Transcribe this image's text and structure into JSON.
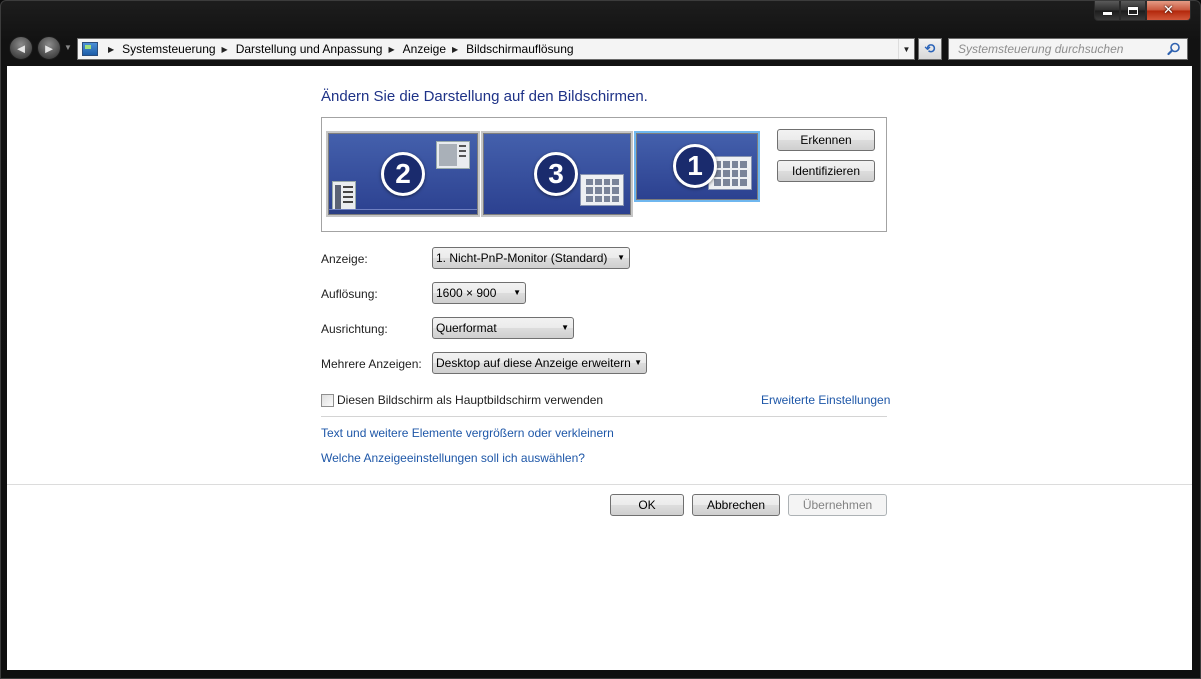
{
  "window": {
    "caption_buttons": {
      "minimize_icon": "minimize-icon",
      "maximize_icon": "maximize-icon",
      "close_icon": "close-icon",
      "close_glyph": "✕"
    }
  },
  "nav": {
    "back_glyph": "◄",
    "forward_glyph": "►",
    "breadcrumbs": [
      "Systemsteuerung",
      "Darstellung und Anpassung",
      "Anzeige",
      "Bildschirmauflösung"
    ],
    "refresh_glyph": "⟲",
    "search_placeholder": "Systemsteuerung durchsuchen"
  },
  "main": {
    "title": "Ändern Sie die Darstellung auf den Bildschirmen.",
    "monitors": [
      {
        "number": "2",
        "selected": false
      },
      {
        "number": "3",
        "selected": false
      },
      {
        "number": "1",
        "selected": true
      }
    ],
    "detect_button": "Erkennen",
    "identify_button": "Identifizieren",
    "fields": {
      "display_label": "Anzeige:",
      "display_value": "1. Nicht-PnP-Monitor (Standard)",
      "resolution_label": "Auflösung:",
      "resolution_value": "1600 × 900",
      "orientation_label": "Ausrichtung:",
      "orientation_value": "Querformat",
      "multiple_label": "Mehrere Anzeigen:",
      "multiple_value": "Desktop auf diese Anzeige erweitern"
    },
    "primary_checkbox_label": "Diesen Bildschirm als Hauptbildschirm verwenden",
    "primary_checked": false,
    "advanced_link": "Erweiterte Einstellungen",
    "link_text_size": "Text und weitere Elemente vergrößern oder verkleinern",
    "link_which_settings": "Welche Anzeigeeinstellungen soll ich auswählen?"
  },
  "footer": {
    "ok": "OK",
    "cancel": "Abbrechen",
    "apply": "Übernehmen",
    "apply_enabled": false
  },
  "colors": {
    "link": "#1e57a8",
    "title": "#1e3287",
    "monitor_fill": "#3a53a2",
    "selected_outline": "#6fb7ef"
  }
}
